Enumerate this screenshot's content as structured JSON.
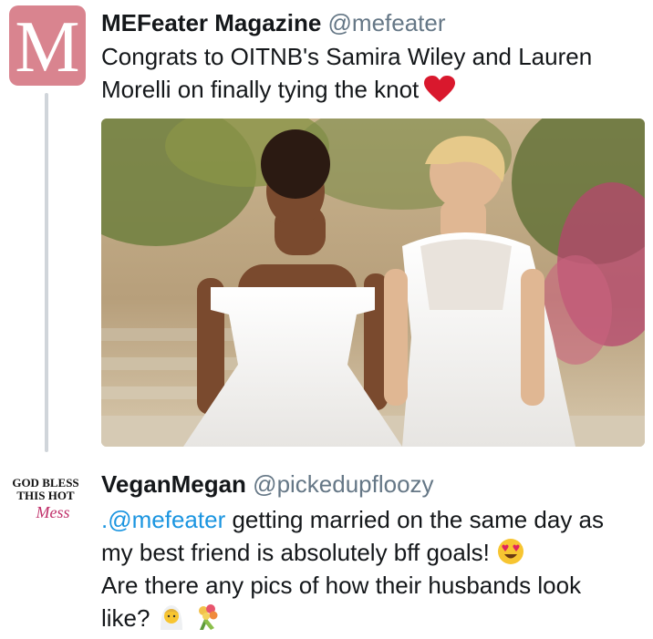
{
  "tweet1": {
    "avatar_letter": "M",
    "display_name": "MEFeater Magazine",
    "handle": "@mefeater",
    "text_line1": "Congrats to OITNB's Samira Wiley and Lauren",
    "text_line2": "Morelli on finally tying the knot",
    "emoji": "red-heart-icon"
  },
  "tweet2": {
    "avatar_text_line1": "GOD BLESS",
    "avatar_text_line2": "THIS HOT",
    "avatar_text_line3": "Mess",
    "display_name": "VeganMegan",
    "handle": "@pickedupfloozy",
    "mention": ".@mefeater",
    "line1_rest": " getting married on the same day as",
    "line2": "my best friend is absolutely bff goals!",
    "line3": "Are there any pics of how their husbands look",
    "line4": "like?",
    "emojis": [
      "heart-eyes-face-icon",
      "bride-with-veil-icon",
      "bouquet-icon"
    ]
  },
  "colors": {
    "brand_avatar": "#d9848f",
    "mention": "#1b95e0",
    "handle": "#657786",
    "heart": "#e0245e"
  }
}
